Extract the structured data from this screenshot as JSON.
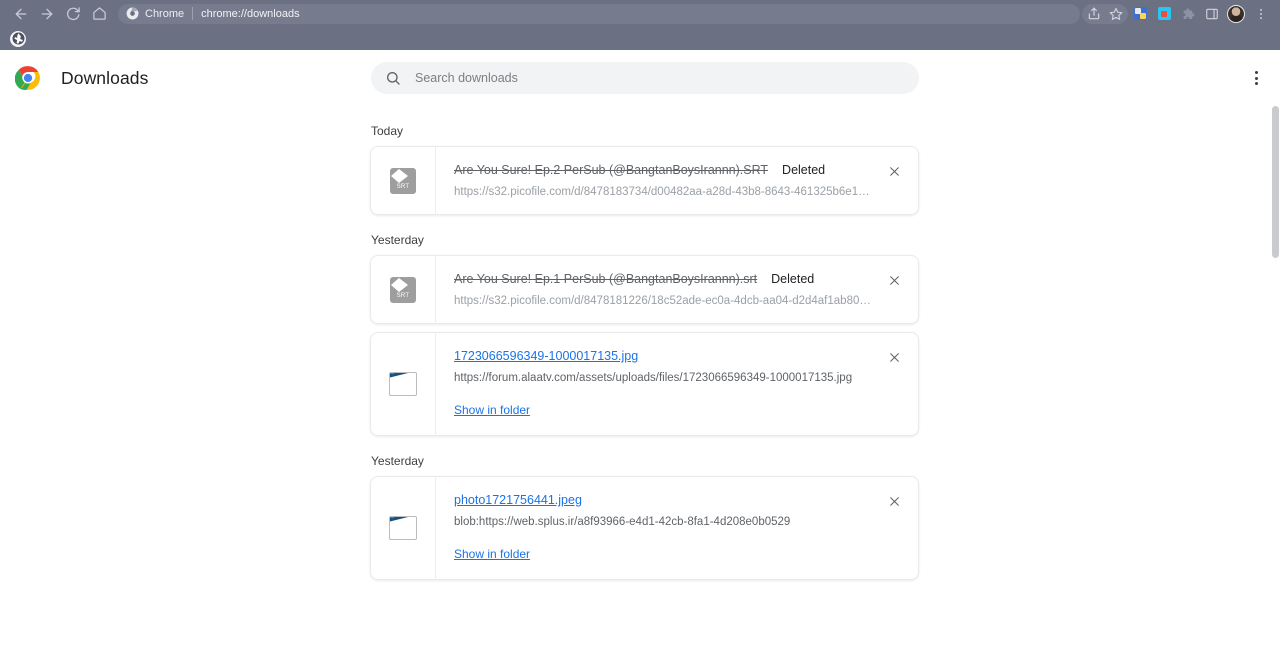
{
  "browser": {
    "nav": {
      "back_icon": "arrow-left-icon",
      "forward_icon": "arrow-right-icon",
      "reload_icon": "reload-icon",
      "home_icon": "home-icon"
    },
    "omnibox": {
      "app_label": "Chrome",
      "url": "chrome://downloads",
      "chrome_icon": "chrome-icon"
    },
    "toolbar_icons": [
      "share-icon",
      "bookmark-star-icon",
      "extension-translate-icon",
      "extension-recorder-icon",
      "extensions-puzzle-icon",
      "side-panel-icon"
    ],
    "profile": "profile-avatar",
    "browser_menu_icon": "browser-menu-icon",
    "bookmarks": [
      {
        "icon": "globe-bookmark-icon"
      }
    ]
  },
  "header": {
    "logo": "chrome-logo-icon",
    "title": "Downloads",
    "search": {
      "icon": "search-icon",
      "placeholder": "Search downloads",
      "value": ""
    },
    "more_menu_label": "more-options"
  },
  "colors": {
    "chrome_toolbar": "#6b7183",
    "link": "#1a73e8",
    "text_primary": "#202124",
    "text_secondary": "#5f6368",
    "card_border": "#e8eaed",
    "search_bg": "#f1f3f4"
  },
  "groups": [
    {
      "label": "Today",
      "items": [
        {
          "file_name": "Are You Sure! Ep.2 PerSub (@BangtanBoysIrannn).SRT",
          "deleted": true,
          "status": "Deleted",
          "url": "https://s32.picofile.com/d/8478183734/d00482aa-a28d-43b8-8643-461325b6e192/...",
          "icon": "srt-file-icon",
          "icon_label": "SRT",
          "action": null,
          "close_label": "remove-from-list"
        }
      ]
    },
    {
      "label": "Yesterday",
      "items": [
        {
          "file_name": "Are You Sure! Ep.1 PerSub (@BangtanBoysIrannn).srt",
          "deleted": true,
          "status": "Deleted",
          "url": "https://s32.picofile.com/d/8478181226/18c52ade-ec0a-4dcb-aa04-d2d4af1ab80d/A...",
          "icon": "srt-file-icon",
          "icon_label": "SRT",
          "action": null,
          "close_label": "remove-from-list"
        },
        {
          "file_name": "1723066596349-1000017135.jpg",
          "deleted": false,
          "status": "",
          "url": "https://forum.alaatv.com/assets/uploads/files/1723066596349-1000017135.jpg",
          "icon": "image-file-icon",
          "icon_label": "",
          "action": "Show in folder",
          "close_label": "remove-from-list"
        }
      ]
    },
    {
      "label": "Yesterday",
      "items": [
        {
          "file_name": "photo1721756441.jpeg",
          "deleted": false,
          "status": "",
          "url": "blob:https://web.splus.ir/a8f93966-e4d1-42cb-8fa1-4d208e0b0529",
          "icon": "image-file-icon",
          "icon_label": "",
          "action": "Show in folder",
          "close_label": "remove-from-list"
        }
      ]
    }
  ]
}
